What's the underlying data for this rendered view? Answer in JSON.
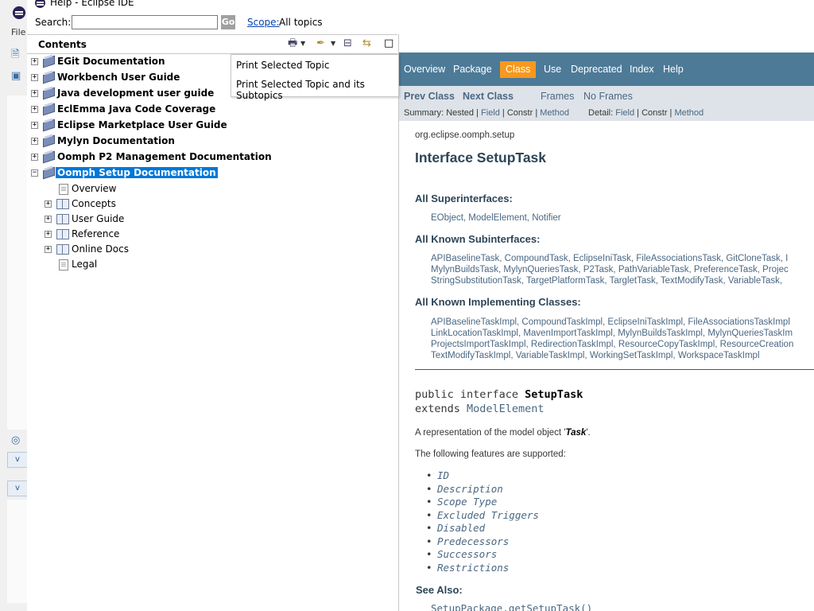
{
  "window": {
    "title": "Help - Eclipse IDE"
  },
  "background_window": {
    "menu_file": "File",
    "dropdown_glyph": "v"
  },
  "search": {
    "label": "Search:",
    "value": "",
    "go_label": "Go",
    "scope_link": "Scope:",
    "scope_value": "All topics"
  },
  "contents": {
    "title": "Contents",
    "icons": [
      "print-icon",
      "dropdown-icon",
      "highlight-search-icon",
      "dropdown-icon",
      "collapse-all-icon",
      "link-with-contents-icon",
      "maximize-icon"
    ],
    "books": [
      {
        "label": "EGit Documentation"
      },
      {
        "label": "Workbench User Guide"
      },
      {
        "label": "Java development user guide"
      },
      {
        "label": "EclEmma Java Code Coverage"
      },
      {
        "label": "Eclipse Marketplace User Guide"
      },
      {
        "label": "Mylyn Documentation"
      },
      {
        "label": "Oomph P2 Management Documentation"
      },
      {
        "label": "Oomph Setup Documentation",
        "selected": true
      }
    ],
    "children": [
      {
        "label": "Overview",
        "type": "page"
      },
      {
        "label": "Concepts",
        "type": "book"
      },
      {
        "label": "User Guide",
        "type": "book"
      },
      {
        "label": "Reference",
        "type": "book"
      },
      {
        "label": "Online Docs",
        "type": "book"
      },
      {
        "label": "Legal",
        "type": "page"
      }
    ]
  },
  "print_menu": {
    "items": [
      "Print Selected Topic",
      "Print Selected Topic and its Subtopics"
    ]
  },
  "javadoc": {
    "nav": {
      "overview": "Overview",
      "package": "Package",
      "class": "Class",
      "use": "Use",
      "deprecated": "Deprecated",
      "index": "Index",
      "help": "Help"
    },
    "subnav": {
      "prev": "Prev Class",
      "next": "Next Class",
      "frames": "Frames",
      "noframes": "No Frames",
      "summary_label": "Summary:",
      "summary_nested": "Nested",
      "summary_field": "Field",
      "summary_constr": "Constr",
      "summary_method": "Method",
      "detail_label": "Detail:",
      "detail_field": "Field",
      "detail_constr": "Constr",
      "detail_method": "Method"
    },
    "package": "org.eclipse.oomph.setup",
    "title": "Interface SetupTask",
    "superinterfaces_title": "All Superinterfaces:",
    "superinterfaces": "EObject, ModelElement, Notifier",
    "subinterfaces_title": "All Known Subinterfaces:",
    "subinterfaces_lines": [
      "APIBaselineTask, CompoundTask, EclipseIniTask, FileAssociationsTask, GitCloneTask, I",
      "MylynBuildsTask, MylynQueriesTask, P2Task, PathVariableTask, PreferenceTask, Projec",
      "StringSubstitutionTask, TargetPlatformTask, TargletTask, TextModifyTask, VariableTask,"
    ],
    "implementing_title": "All Known Implementing Classes:",
    "implementing_lines": [
      "APIBaselineTaskImpl, CompoundTaskImpl, EclipseIniTaskImpl, FileAssociationsTaskImpl",
      "LinkLocationTaskImpl, MavenImportTaskImpl, MylynBuildsTaskImpl, MylynQueriesTaskIm",
      "ProjectsImportTaskImpl, RedirectionTaskImpl, ResourceCopyTaskImpl, ResourceCreation",
      "TextModifyTaskImpl, VariableTaskImpl, WorkingSetTaskImpl, WorkspaceTaskImpl"
    ],
    "decl_prefix": "public interface ",
    "decl_name": "SetupTask",
    "decl_extends": "extends ",
    "decl_parent": "ModelElement",
    "desc_prefix": "A representation of the model object '",
    "desc_obj": "Task",
    "desc_suffix": "'.",
    "features_intro": "The following features are supported:",
    "features": [
      "ID",
      "Description",
      "Scope Type",
      "Excluded Triggers",
      "Disabled",
      "Predecessors",
      "Successors",
      "Restrictions"
    ],
    "see_also_title": "See Also:",
    "see_also_link": "SetupPackage.getSetupTask()"
  }
}
